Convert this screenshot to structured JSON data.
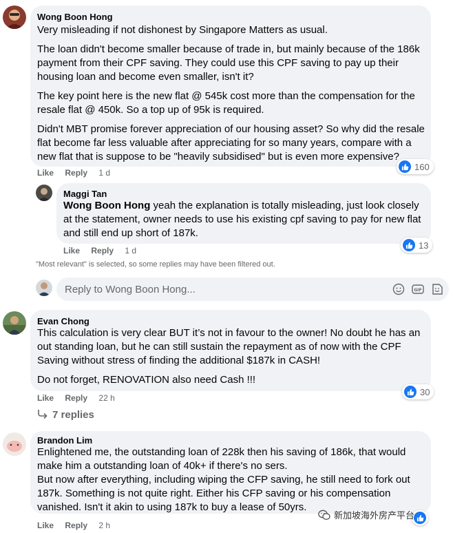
{
  "comments": [
    {
      "author": "Wong Boon Hong",
      "paragraphs": [
        "Very misleading if not dishonest by Singapore Matters as usual.",
        "The loan didn't become smaller because of trade in, but mainly because of the 186k payment from their CPF saving. They could use this CPF saving to pay up their housing loan and become even smaller, isn't it?",
        "The key point here is the new flat @ 545k cost more than the compensation for the resale flat @ 450k. So a top up of 95k is required.",
        "Didn't MBT promise forever appreciation of our housing asset? So why did the resale flat become far less valuable after appreciating for so many years, compare with a new flat that is suppose to be \"heavily subsidised\" but is even more expensive?"
      ],
      "like_label": "Like",
      "reply_label": "Reply",
      "time": "1 d",
      "reaction_count": "160"
    },
    {
      "author": "Maggi Tan",
      "mention": "Wong Boon Hong",
      "text": " yeah the explanation is totally misleading, just look closely at the statement, owner needs to use his existing cpf saving to pay for new flat and still end up short of 187k.",
      "like_label": "Like",
      "reply_label": "Reply",
      "time": "1 d",
      "reaction_count": "13"
    },
    {
      "author": "Evan Chong",
      "paragraphs": [
        "This calculation is very clear BUT it’s not in favour to the owner! No doubt he has an out standing loan, but he can still sustain the repayment as of now with the CPF Saving without stress of finding the additional $187k in CASH!",
        "Do not forget, RENOVATION also need Cash !!!"
      ],
      "like_label": "Like",
      "reply_label": "Reply",
      "time": "22 h",
      "reaction_count": "30",
      "replies_label": "7 replies"
    },
    {
      "author": "Brandon Lim",
      "paragraphs": [
        "Enlightened me, the outstanding loan of 228k then his saving of 186k, that would make him a outstanding loan of 40k+ if there's no sers.",
        "But now after everything, including wiping the CFP saving, he still need to fork out 187k. Something is not quite right. Either his CFP saving or his compensation vanished. Isn't it akin to using 187k to buy a lease of 50yrs."
      ],
      "like_label": "Like",
      "reply_label": "Reply",
      "time": "2 h"
    }
  ],
  "filter_note": "\"Most relevant\" is selected, so some replies may have been filtered out.",
  "reply_box": {
    "placeholder": "Reply to Wong Boon Hong..."
  },
  "watermark": {
    "text": "新加坡海外房产平台"
  },
  "icons": {
    "like": "thumbs-up-icon",
    "emoji": "smiley-icon",
    "gif": "gif-icon",
    "sticker": "sticker-icon",
    "replies": "reply-arrow-icon",
    "watermark": "wechat-icon"
  },
  "colors": {
    "like_blue": "#1877f2",
    "bubble": "#f0f2f5",
    "secondary_text": "#65676b"
  }
}
